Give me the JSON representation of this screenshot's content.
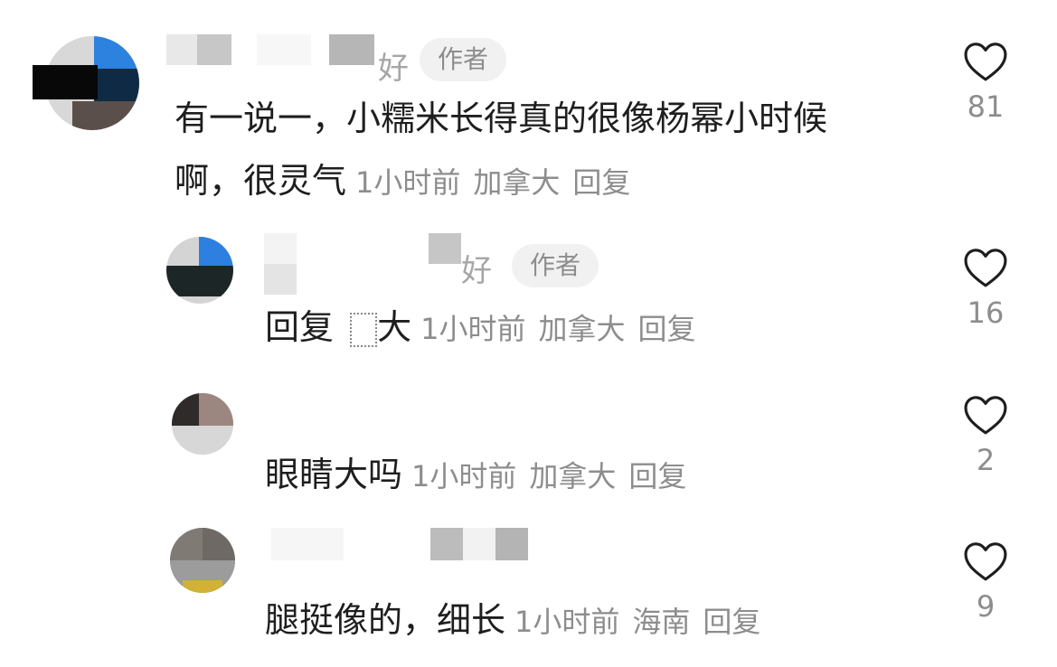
{
  "comments": [
    {
      "name_visible_fragment": "好",
      "badge": "作者",
      "text_line1": "有一说一，小糯米长得真的很像杨幂小时候",
      "text_line2": "啊，很灵气",
      "time": "1小时前",
      "location": "加拿大",
      "reply_label": "回复",
      "likes": "81"
    },
    {
      "name_visible_fragment": "好",
      "badge": "作者",
      "reply_prefix": "回复",
      "reply_target": "大",
      "time": "1小时前",
      "location": "加拿大",
      "reply_label": "回复",
      "likes": "16"
    },
    {
      "text": "眼睛大吗",
      "time": "1小时前",
      "location": "加拿大",
      "reply_label": "回复",
      "likes": "2"
    },
    {
      "text": "腿挺像的，细长",
      "time": "1小时前",
      "location": "海南",
      "reply_label": "回复",
      "likes": "9"
    }
  ],
  "icons": {
    "like": "heart-outline-icon"
  },
  "colors": {
    "text": "#1e1e1e",
    "meta": "#8d8d8d",
    "badge_bg": "#f1f1f1"
  }
}
